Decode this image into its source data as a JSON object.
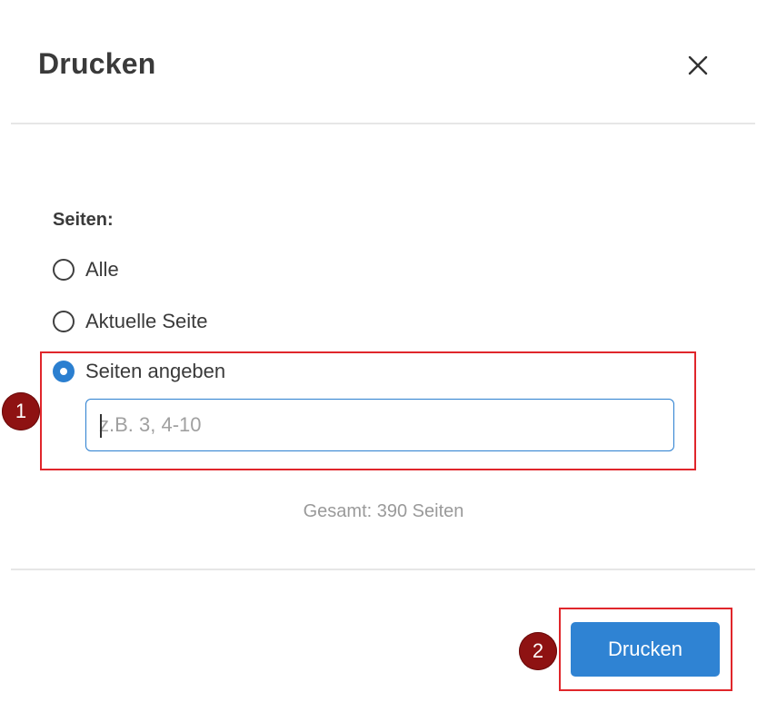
{
  "dialog": {
    "title": "Drucken",
    "close_icon": "close-icon"
  },
  "pages": {
    "label": "Seiten:",
    "options": [
      {
        "label": "Alle",
        "selected": false
      },
      {
        "label": "Aktuelle Seite",
        "selected": false
      },
      {
        "label": "Seiten angeben",
        "selected": true
      }
    ],
    "input_value": "",
    "input_placeholder": "z.B. 3, 4-10",
    "total": "Gesamt: 390 Seiten"
  },
  "footer": {
    "print_label": "Drucken"
  },
  "annotations": {
    "marker1": "1",
    "marker2": "2",
    "highlight_color": "#e0262b",
    "marker_color": "#8e1212"
  },
  "colors": {
    "accent": "#2f83d3"
  }
}
